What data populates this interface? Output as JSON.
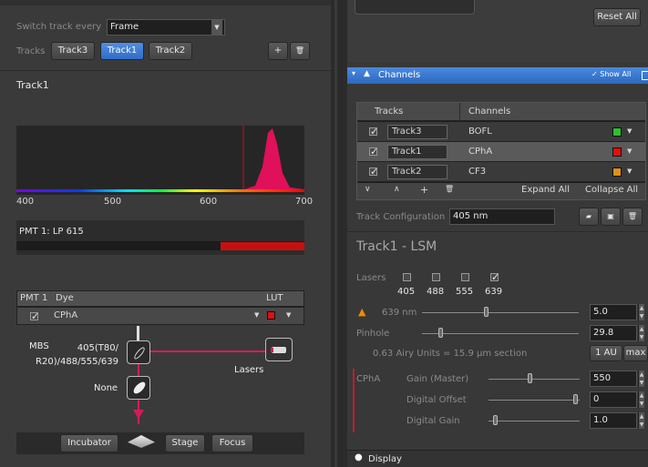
{
  "left": {
    "switch_label": "Switch track every",
    "switch_value": "Frame",
    "tracks_label": "Tracks",
    "tracks": [
      "Track3",
      "Track1",
      "Track2"
    ],
    "add_glyph": "+",
    "delete_glyph": "🗑",
    "track_title": "Track1",
    "spectrum_ticks": [
      "400",
      "500",
      "600",
      "700"
    ],
    "pmt_label": "PMT 1: LP 615",
    "dye_headers": {
      "pmt": "PMT 1",
      "dye": "Dye",
      "lut": "LUT"
    },
    "dye_row": "CPhA",
    "mbs_label": "MBS",
    "mbs_value": "405(T80/\nR20)/488/555/639",
    "lasers_label": "Lasers",
    "none_label": "None",
    "bottom_buttons": [
      "Incubator",
      "Stage",
      "Focus"
    ]
  },
  "right": {
    "reset_all": "Reset All",
    "channels_title": "Channels",
    "show_all": "Show All",
    "table_headers": [
      "Tracks",
      "Channels"
    ],
    "rows": [
      {
        "track": "Track3",
        "channel": "BOFL",
        "color": "#2fbf2f"
      },
      {
        "track": "Track1",
        "channel": "CPhA",
        "color": "#e01010"
      },
      {
        "track": "Track2",
        "channel": "CF3",
        "color": "#e0901a"
      }
    ],
    "expand_all": "Expand All",
    "collapse_all": "Collapse All",
    "track_config_label": "Track Configuration",
    "track_config_value": "405 nm",
    "section_title": "Track1 - LSM",
    "lasers_label": "Lasers",
    "lasers": [
      {
        "wl": "405",
        "checked": false
      },
      {
        "wl": "488",
        "checked": false
      },
      {
        "wl": "555",
        "checked": false
      },
      {
        "wl": "639",
        "checked": true
      }
    ],
    "laser_line": "639 nm",
    "laser_value": "5.0",
    "pinhole_label": "Pinhole",
    "pinhole_value": "29.8",
    "airy_text": "0.63 Airy Units  =  15.9 µm section",
    "one_au": "1 AU",
    "max": "max",
    "channel_name": "CPhA",
    "gain_label": "Gain (Master)",
    "gain_value": "550",
    "offset_label": "Digital Offset",
    "offset_value": "0",
    "dgain_label": "Digital Gain",
    "dgain_value": "1.0",
    "display_label": "Display"
  },
  "colors": {
    "accent": "#3b78d8",
    "spectrum_peak": "#e0105a"
  }
}
